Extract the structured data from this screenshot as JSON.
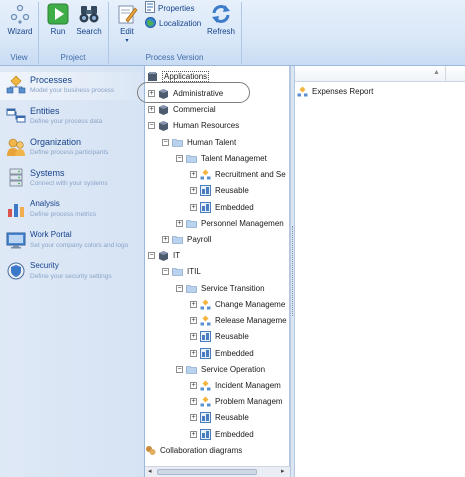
{
  "ribbon": {
    "buttons": {
      "wizard": "Wizard",
      "run": "Run",
      "search": "Search",
      "edit": "Edit",
      "properties": "Properties",
      "localization": "Localization",
      "refresh": "Refresh"
    },
    "groups": {
      "view": "View",
      "project": "Project",
      "process_version": "Process Version"
    }
  },
  "leftnav": {
    "items": [
      {
        "title": "Processes",
        "subtitle": "Model your business process"
      },
      {
        "title": "Entities",
        "subtitle": "Define your process data"
      },
      {
        "title": "Organization",
        "subtitle": "Define process participants"
      },
      {
        "title": "Systems",
        "subtitle": "Connect with your systems"
      },
      {
        "title": "Analysis",
        "subtitle": "Define process metrics"
      },
      {
        "title": "Work Portal",
        "subtitle": "Set your company colors and logo"
      },
      {
        "title": "Security",
        "subtitle": "Define your security settings"
      }
    ]
  },
  "tree": {
    "root": "Applications",
    "nodes": [
      "Administrative",
      "Commercial",
      "Human Resources",
      "Human Talent",
      "Talent Managemet",
      "Recruitment and Se",
      "Reusable",
      "Embedded",
      "Personnel Managemen",
      "Payroll",
      "IT",
      "ITIL",
      "Service Transition",
      "Change Manageme",
      "Release Manageme",
      "Reusable",
      "Embedded",
      "Service Operation",
      "Incident Managem",
      "Problem Managem",
      "Reusable",
      "Embedded"
    ],
    "collaboration": "Collaboration diagrams"
  },
  "details": {
    "items": [
      "Expenses Report"
    ]
  },
  "colors": {
    "ribbon_text": "#15428b",
    "nav_subtitle": "#8aa4c8",
    "folder": "#f2c94c"
  }
}
